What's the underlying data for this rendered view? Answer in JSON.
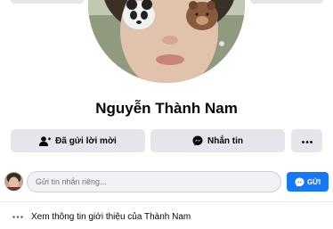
{
  "profile": {
    "name": "Nguyễn Thành Nam"
  },
  "actions": {
    "add_friend_label": "Đã gửi lời mời",
    "message_label": "Nhắn tin",
    "more_icon": "more-dots-icon"
  },
  "composer": {
    "placeholder": "Gửi tin nhắn riêng...",
    "send_label": "GỬI"
  },
  "about": {
    "label": "Xem thông tin giới thiệu của Thành Nam"
  },
  "colors": {
    "accent": "#1877f2",
    "button_bg": "#e4e6eb",
    "input_bg": "#f0f2f5"
  }
}
